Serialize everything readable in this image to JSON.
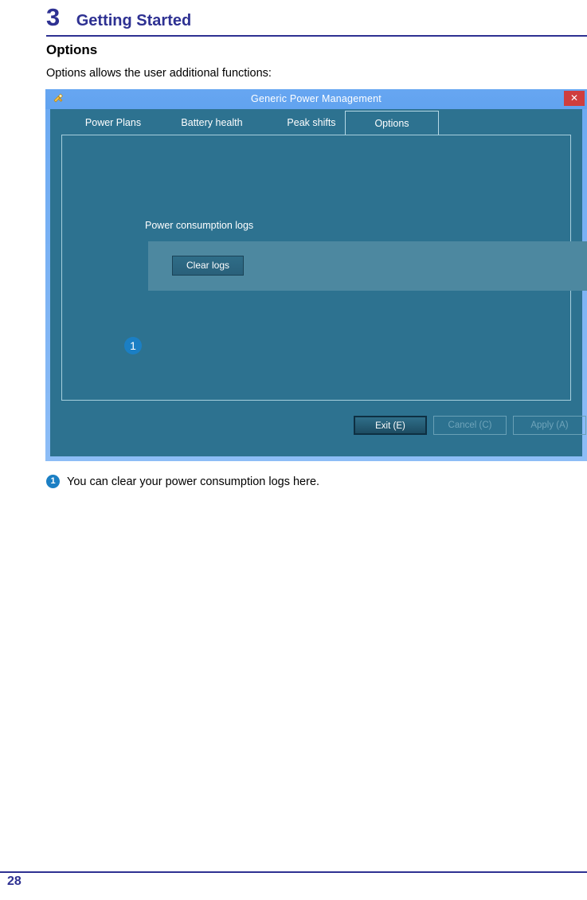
{
  "page": {
    "chapter_number": "3",
    "chapter_title": "Getting Started",
    "section_title": "Options",
    "section_intro": "Options allows the user additional functions:",
    "page_number": "28",
    "accent_color": "#2e3192"
  },
  "caption": {
    "badge": "1",
    "text": "You can clear your power consumption logs here."
  },
  "dialog": {
    "title": "Generic Power Management",
    "title_icon": "power-plug-icon",
    "close_label": "✕",
    "accent_color": "#2d7290",
    "titlebar_color": "#63a6f0",
    "tabs": [
      {
        "label": "Power Plans",
        "active": false
      },
      {
        "label": "Battery health",
        "active": false
      },
      {
        "label": "Peak shifts",
        "active": false
      },
      {
        "label": "Options",
        "active": true
      }
    ],
    "content": {
      "group_label": "Power consumption logs",
      "clear_button": "Clear logs",
      "badge": "1"
    },
    "buttons": [
      {
        "label": "Exit (E)",
        "state": "primary"
      },
      {
        "label": "Cancel (C)",
        "state": "disabled"
      },
      {
        "label": "Apply (A)",
        "state": "disabled"
      }
    ]
  }
}
